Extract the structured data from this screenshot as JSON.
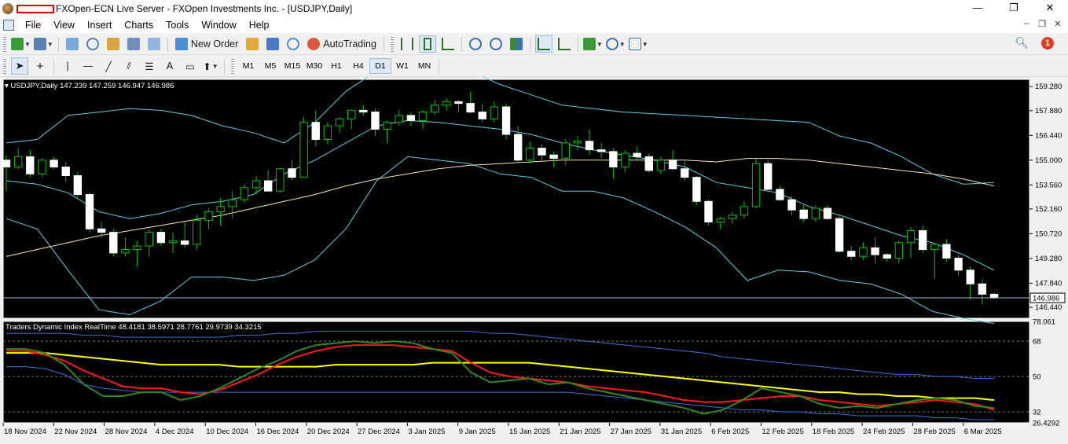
{
  "window": {
    "title": "FXOpen-ECN Live Server - FXOpen Investments Inc. - [USDJPY,Daily]",
    "controls": [
      "—",
      "❐",
      "✕"
    ]
  },
  "menu": [
    "File",
    "View",
    "Insert",
    "Charts",
    "Tools",
    "Window",
    "Help"
  ],
  "toolbar": {
    "new_order": "New Order",
    "autotrading": "AutoTrading"
  },
  "timeframes": [
    "M1",
    "M5",
    "M15",
    "M30",
    "H1",
    "H4",
    "D1",
    "W1",
    "MN"
  ],
  "active_timeframe": "D1",
  "notification_count": "1",
  "chart": {
    "symbol_label": "USDJPY,Daily",
    "ohlc": "147.239 147.259 146.947 146.986",
    "current_price": "146.986",
    "price_axis": [
      "159.280",
      "157.880",
      "156.440",
      "155.000",
      "153.560",
      "152.160",
      "150.720",
      "149.280",
      "147.840",
      "146.440"
    ],
    "indicator_label": "Traders Dynamic Index RealTime 48.4181 38.5971 28.7761 29.9739 34.3215",
    "indicator_axis": [
      "78.061",
      "68",
      "50",
      "32",
      "26.4292"
    ],
    "date_axis": [
      "18 Nov 2024",
      "22 Nov 2024",
      "28 Nov 2024",
      "4 Dec 2024",
      "10 Dec 2024",
      "16 Dec 2024",
      "20 Dec 2024",
      "27 Dec 2024",
      "3 Jan 2025",
      "9 Jan 2025",
      "15 Jan 2025",
      "21 Jan 2025",
      "27 Jan 2025",
      "31 Jan 2025",
      "6 Feb 2025",
      "12 Feb 2025",
      "18 Feb 2025",
      "24 Feb 2025",
      "28 Feb 2025",
      "6 Mar 2025"
    ]
  },
  "colors": {
    "background": "#000000",
    "bull_candle": "#000000",
    "bear_candle": "#ffffff",
    "wick": "#00c800",
    "bollinger": "#5fd0e6",
    "ma": "#ffe4b5",
    "tdi_green": "#2e8b1e",
    "tdi_red": "#ff1a1a",
    "tdi_yellow": "#ffff00",
    "tdi_band": "#3c6fe0"
  },
  "chart_data": {
    "type": "candlestick",
    "candles": [
      [
        155.0,
        155.3,
        153.2,
        154.6
      ],
      [
        154.6,
        155.7,
        154.5,
        155.2
      ],
      [
        155.2,
        155.6,
        154.0,
        154.2
      ],
      [
        154.2,
        155.1,
        154.0,
        155.0
      ],
      [
        155.0,
        155.2,
        154.5,
        154.6
      ],
      [
        154.6,
        154.9,
        153.7,
        154.1
      ],
      [
        154.1,
        154.3,
        152.8,
        153.0
      ],
      [
        153.0,
        153.1,
        150.8,
        151.0
      ],
      [
        151.0,
        151.4,
        150.5,
        150.8
      ],
      [
        150.8,
        151.0,
        149.4,
        149.6
      ],
      [
        149.6,
        150.5,
        149.4,
        149.8
      ],
      [
        149.8,
        150.3,
        148.8,
        150.0
      ],
      [
        150.0,
        151.0,
        149.4,
        150.8
      ],
      [
        150.8,
        151.0,
        150.0,
        150.2
      ],
      [
        150.2,
        150.8,
        149.6,
        150.3
      ],
      [
        150.3,
        151.4,
        149.9,
        150.1
      ],
      [
        150.1,
        151.8,
        149.8,
        151.5
      ],
      [
        151.5,
        152.2,
        151.0,
        152.0
      ],
      [
        152.0,
        152.8,
        151.2,
        152.3
      ],
      [
        152.3,
        153.2,
        151.6,
        152.7
      ],
      [
        152.7,
        153.6,
        152.5,
        153.4
      ],
      [
        153.4,
        154.1,
        153.0,
        153.8
      ],
      [
        153.8,
        154.4,
        153.2,
        153.2
      ],
      [
        153.2,
        154.3,
        153.1,
        154.5
      ],
      [
        154.5,
        155.0,
        153.8,
        154.0
      ],
      [
        154.0,
        157.5,
        154.0,
        157.2
      ],
      [
        157.2,
        157.9,
        155.8,
        156.2
      ],
      [
        156.2,
        157.2,
        155.9,
        157.0
      ],
      [
        157.0,
        157.5,
        156.6,
        157.4
      ],
      [
        157.4,
        157.8,
        156.8,
        157.9
      ],
      [
        157.9,
        158.2,
        157.6,
        157.8
      ],
      [
        157.8,
        158.0,
        156.4,
        156.8
      ],
      [
        156.8,
        157.3,
        156.0,
        157.2
      ],
      [
        157.2,
        157.9,
        157.0,
        157.6
      ],
      [
        157.6,
        157.8,
        157.0,
        157.3
      ],
      [
        157.3,
        157.9,
        156.8,
        157.8
      ],
      [
        157.8,
        158.5,
        157.6,
        158.2
      ],
      [
        158.2,
        158.6,
        157.9,
        158.4
      ],
      [
        158.4,
        158.5,
        157.8,
        158.3
      ],
      [
        158.3,
        159.0,
        157.7,
        157.8
      ],
      [
        157.8,
        158.3,
        157.2,
        157.4
      ],
      [
        157.4,
        158.4,
        157.2,
        158.1
      ],
      [
        158.1,
        158.3,
        156.2,
        156.5
      ],
      [
        156.5,
        157.0,
        154.9,
        155.0
      ],
      [
        155.0,
        156.1,
        154.8,
        155.7
      ],
      [
        155.7,
        155.9,
        154.9,
        155.3
      ],
      [
        155.3,
        155.5,
        154.6,
        155.1
      ],
      [
        155.1,
        156.2,
        154.7,
        156.0
      ],
      [
        156.0,
        156.4,
        155.6,
        156.1
      ],
      [
        156.1,
        156.8,
        155.3,
        155.6
      ],
      [
        155.6,
        156.0,
        155.1,
        155.5
      ],
      [
        155.5,
        155.7,
        153.9,
        154.6
      ],
      [
        154.6,
        155.6,
        154.3,
        155.4
      ],
      [
        155.4,
        155.8,
        155.0,
        155.2
      ],
      [
        155.2,
        155.4,
        154.3,
        154.4
      ],
      [
        154.4,
        155.2,
        154.2,
        155.0
      ],
      [
        155.0,
        155.6,
        154.4,
        154.5
      ],
      [
        154.5,
        155.0,
        153.8,
        154.0
      ],
      [
        154.0,
        154.1,
        152.4,
        152.6
      ],
      [
        152.6,
        152.7,
        151.2,
        151.4
      ],
      [
        151.4,
        151.7,
        151.0,
        151.6
      ],
      [
        151.6,
        152.0,
        151.3,
        151.8
      ],
      [
        151.8,
        152.6,
        151.6,
        152.3
      ],
      [
        152.3,
        155.1,
        152.2,
        154.8
      ],
      [
        154.8,
        155.0,
        153.2,
        153.3
      ],
      [
        153.3,
        153.5,
        152.6,
        152.7
      ],
      [
        152.7,
        152.9,
        151.8,
        152.1
      ],
      [
        152.1,
        152.4,
        151.4,
        151.6
      ],
      [
        151.6,
        152.4,
        151.4,
        152.2
      ],
      [
        152.2,
        152.4,
        151.5,
        151.6
      ],
      [
        151.6,
        151.8,
        149.6,
        149.7
      ],
      [
        149.7,
        150.0,
        149.2,
        149.4
      ],
      [
        149.4,
        150.2,
        149.2,
        149.9
      ],
      [
        149.9,
        150.5,
        149.0,
        149.5
      ],
      [
        149.5,
        149.6,
        149.1,
        149.3
      ],
      [
        149.3,
        150.3,
        149.0,
        150.2
      ],
      [
        150.2,
        151.1,
        149.3,
        150.9
      ],
      [
        150.9,
        151.2,
        149.6,
        149.8
      ],
      [
        149.8,
        150.0,
        148.1,
        150.1
      ],
      [
        150.1,
        150.4,
        149.1,
        149.3
      ],
      [
        149.3,
        149.5,
        148.3,
        148.6
      ],
      [
        148.6,
        148.8,
        146.9,
        147.8
      ],
      [
        147.8,
        148.1,
        146.6,
        147.2
      ],
      [
        147.2,
        147.3,
        146.9,
        146.986
      ]
    ],
    "bb_upper": [
      156.0,
      156.2,
      157.6,
      157.8,
      158.0,
      157.9,
      157.6,
      157.0,
      156.6,
      156.0,
      157.2,
      159.0,
      160.2,
      160.6,
      160.6,
      160.2,
      159.4,
      158.8,
      158.2,
      158.0,
      157.8,
      157.7,
      157.6,
      157.5,
      157.4,
      157.3,
      157.2,
      156.4,
      156.0,
      155.2,
      154.2,
      153.6,
      153.7
    ],
    "bb_middle": [
      153.8,
      153.6,
      153.1,
      152.0,
      151.6,
      151.9,
      152.4,
      152.6,
      153.0,
      154.2,
      155.0,
      156.0,
      157.0,
      157.3,
      157.2,
      157.0,
      156.8,
      156.5,
      156.0,
      155.6,
      155.3,
      155.0,
      154.6,
      153.7,
      153.4,
      153.1,
      152.3,
      151.8,
      151.2,
      150.6,
      150.2,
      149.5,
      148.6
    ],
    "bb_lower": [
      151.6,
      151.0,
      148.6,
      146.3,
      146.0,
      146.8,
      148.2,
      148.2,
      148.0,
      148.3,
      149.2,
      151.0,
      153.8,
      155.2,
      155.0,
      154.8,
      154.2,
      154.0,
      153.2,
      153.2,
      152.8,
      152.0,
      151.1,
      149.9,
      148.0,
      148.6,
      148.5,
      148.0,
      147.8,
      147.2,
      146.2,
      145.8,
      145.5
    ],
    "ma": [
      149.4,
      149.8,
      150.2,
      150.6,
      150.9,
      151.2,
      151.5,
      151.8,
      152.2,
      152.6,
      153.0,
      153.5,
      153.9,
      154.2,
      154.5,
      154.7,
      154.8,
      154.9,
      155.0,
      155.0,
      155.0,
      155.0,
      155.0,
      154.9,
      155.1,
      155.1,
      155.0,
      154.8,
      154.6,
      154.4,
      154.2,
      153.9,
      153.5
    ],
    "tdi_green": [
      64,
      64,
      62,
      56,
      46,
      40,
      40,
      42,
      42,
      38,
      40,
      44,
      49,
      54,
      58,
      63,
      66,
      67,
      68,
      67,
      68,
      67,
      64,
      62,
      52,
      47,
      48,
      49,
      46,
      47,
      44,
      42,
      40,
      38,
      36,
      34,
      31,
      33,
      38,
      44,
      42,
      40,
      36,
      34,
      35,
      34,
      36,
      38,
      39,
      38,
      35,
      34
    ],
    "tdi_red": [
      63,
      63,
      61,
      58,
      53,
      49,
      45,
      44,
      44,
      42,
      41,
      43,
      47,
      51,
      56,
      60,
      63,
      65,
      66,
      66,
      66,
      65,
      64,
      63,
      57,
      52,
      50,
      49,
      48,
      47,
      45,
      44,
      43,
      42,
      40,
      38,
      37,
      37,
      38,
      39,
      40,
      40,
      38,
      37,
      36,
      35,
      36,
      37,
      38,
      37,
      36,
      33
    ],
    "tdi_yellow": [
      62,
      62,
      62,
      61,
      60,
      59,
      58,
      57,
      56,
      56,
      56,
      56,
      55,
      55,
      55,
      55,
      55,
      56,
      56,
      56,
      56,
      56,
      57,
      57,
      57,
      57,
      57,
      57,
      56,
      55,
      54,
      53,
      52,
      51,
      50,
      49,
      48,
      47,
      46,
      45,
      44,
      43,
      42,
      42,
      41,
      41,
      40,
      40,
      39,
      39,
      39,
      38
    ],
    "tdi_band_upper": [
      72,
      72,
      72,
      72,
      71,
      71,
      70,
      70,
      70,
      70,
      70,
      70,
      71,
      71,
      72,
      72,
      73,
      73,
      73,
      73,
      73,
      73,
      73,
      73,
      73,
      72,
      72,
      71,
      70,
      69,
      68,
      67,
      66,
      65,
      64,
      63,
      62,
      60,
      59,
      58,
      57,
      56,
      55,
      54,
      53,
      52,
      51,
      51,
      50,
      50,
      49,
      49
    ],
    "tdi_band_lower": [
      55,
      55,
      54,
      51,
      46,
      44,
      43,
      42,
      42,
      42,
      42,
      42,
      42,
      42,
      42,
      42,
      42,
      42,
      42,
      42,
      42,
      42,
      42,
      42,
      42,
      42,
      42,
      42,
      42,
      42,
      41,
      40,
      39,
      38,
      37,
      36,
      35,
      34,
      33,
      33,
      32,
      32,
      31,
      31,
      30,
      30,
      30,
      30,
      29,
      29,
      28,
      28
    ],
    "price_range": [
      145.8,
      159.7
    ],
    "indicator_range": [
      26.4292,
      78.061
    ]
  }
}
